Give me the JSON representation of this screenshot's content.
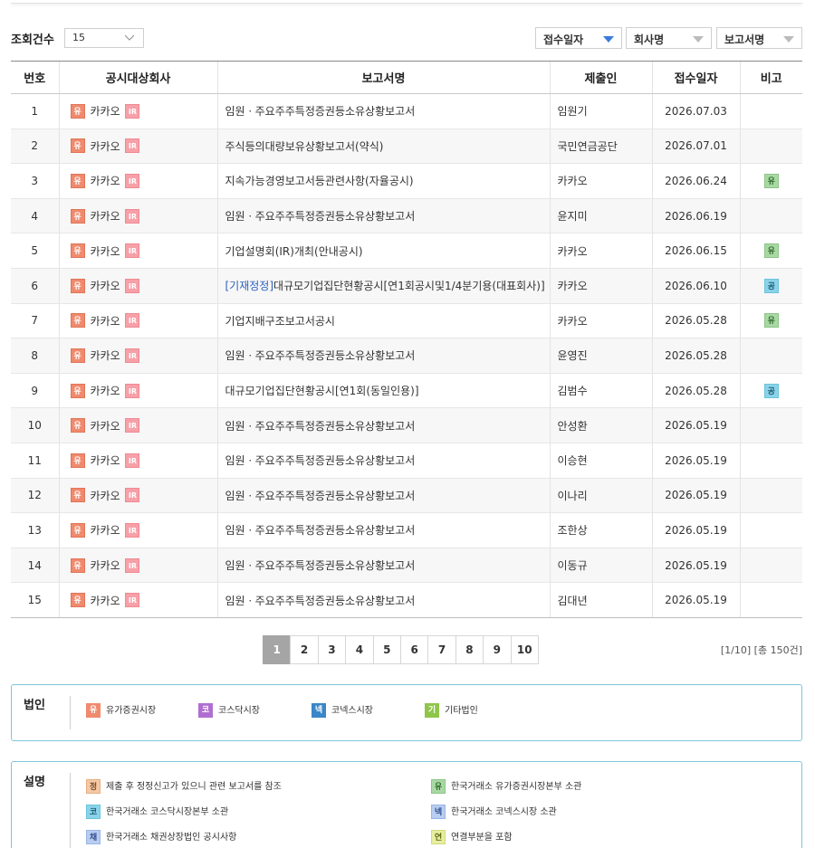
{
  "toolbar": {
    "count_label": "조회건수",
    "count_value": "15",
    "sort_options": [
      "접수일자",
      "회사명",
      "보고서명"
    ]
  },
  "table": {
    "headers": [
      "번호",
      "공시대상회사",
      "보고서명",
      "제출인",
      "접수일자",
      "비고"
    ],
    "rows": [
      {
        "num": "1",
        "market": "유",
        "ir": "IR",
        "company": "카카오",
        "prefix": "",
        "report": "임원ㆍ주요주주특정증권등소유상황보고서",
        "submitter": "임원기",
        "date": "2026.07.03",
        "note": ""
      },
      {
        "num": "2",
        "market": "유",
        "ir": "IR",
        "company": "카카오",
        "prefix": "",
        "report": "주식등의대량보유상황보고서(약식)",
        "submitter": "국민연금공단",
        "date": "2026.07.01",
        "note": ""
      },
      {
        "num": "3",
        "market": "유",
        "ir": "IR",
        "company": "카카오",
        "prefix": "",
        "report": "지속가능경영보고서등관련사항(자율공시)",
        "submitter": "카카오",
        "date": "2026.06.24",
        "note": "유"
      },
      {
        "num": "4",
        "market": "유",
        "ir": "IR",
        "company": "카카오",
        "prefix": "",
        "report": "임원ㆍ주요주주특정증권등소유상황보고서",
        "submitter": "윤지미",
        "date": "2026.06.19",
        "note": ""
      },
      {
        "num": "5",
        "market": "유",
        "ir": "IR",
        "company": "카카오",
        "prefix": "",
        "report": "기업설명회(IR)개최(안내공시)",
        "submitter": "카카오",
        "date": "2026.06.15",
        "note": "유"
      },
      {
        "num": "6",
        "market": "유",
        "ir": "IR",
        "company": "카카오",
        "prefix": "[기재정정]",
        "report": "대규모기업집단현황공시[연1회공시및1/4분기용(대표회사)]",
        "submitter": "카카오",
        "date": "2026.06.10",
        "note": "공"
      },
      {
        "num": "7",
        "market": "유",
        "ir": "IR",
        "company": "카카오",
        "prefix": "",
        "report": "기업지배구조보고서공시",
        "submitter": "카카오",
        "date": "2026.05.28",
        "note": "유"
      },
      {
        "num": "8",
        "market": "유",
        "ir": "IR",
        "company": "카카오",
        "prefix": "",
        "report": "임원ㆍ주요주주특정증권등소유상황보고서",
        "submitter": "윤영진",
        "date": "2026.05.28",
        "note": ""
      },
      {
        "num": "9",
        "market": "유",
        "ir": "IR",
        "company": "카카오",
        "prefix": "",
        "report": "대규모기업집단현황공시[연1회(동일인용)]",
        "submitter": "김범수",
        "date": "2026.05.28",
        "note": "공"
      },
      {
        "num": "10",
        "market": "유",
        "ir": "IR",
        "company": "카카오",
        "prefix": "",
        "report": "임원ㆍ주요주주특정증권등소유상황보고서",
        "submitter": "안성환",
        "date": "2026.05.19",
        "note": ""
      },
      {
        "num": "11",
        "market": "유",
        "ir": "IR",
        "company": "카카오",
        "prefix": "",
        "report": "임원ㆍ주요주주특정증권등소유상황보고서",
        "submitter": "이승현",
        "date": "2026.05.19",
        "note": ""
      },
      {
        "num": "12",
        "market": "유",
        "ir": "IR",
        "company": "카카오",
        "prefix": "",
        "report": "임원ㆍ주요주주특정증권등소유상황보고서",
        "submitter": "이나리",
        "date": "2026.05.19",
        "note": ""
      },
      {
        "num": "13",
        "market": "유",
        "ir": "IR",
        "company": "카카오",
        "prefix": "",
        "report": "임원ㆍ주요주주특정증권등소유상황보고서",
        "submitter": "조한상",
        "date": "2026.05.19",
        "note": ""
      },
      {
        "num": "14",
        "market": "유",
        "ir": "IR",
        "company": "카카오",
        "prefix": "",
        "report": "임원ㆍ주요주주특정증권등소유상황보고서",
        "submitter": "이동규",
        "date": "2026.05.19",
        "note": ""
      },
      {
        "num": "15",
        "market": "유",
        "ir": "IR",
        "company": "카카오",
        "prefix": "",
        "report": "임원ㆍ주요주주특정증권등소유상황보고서",
        "submitter": "김대년",
        "date": "2026.05.19",
        "note": ""
      }
    ]
  },
  "pagination": {
    "pages": [
      "1",
      "2",
      "3",
      "4",
      "5",
      "6",
      "7",
      "8",
      "9",
      "10"
    ],
    "current": "1",
    "info": "[1/10] [총 150건]"
  },
  "corp_legend": {
    "title": "법인",
    "items": [
      {
        "mark": "유",
        "label": "유가증권시장"
      },
      {
        "mark": "코",
        "label": "코스닥시장"
      },
      {
        "mark": "넥",
        "label": "코넥스시장"
      },
      {
        "mark": "기",
        "label": "기타법인"
      }
    ]
  },
  "explain_legend": {
    "title": "설명",
    "items": [
      {
        "mark": "정",
        "label": "제출 후 정정신고가 있으니 관련 보고서를 참조"
      },
      {
        "mark": "유",
        "label": "한국거래소 유가증권시장본부 소관"
      },
      {
        "mark": "코",
        "label": "한국거래소 코스닥시장본부 소관"
      },
      {
        "mark": "넥",
        "label": "한국거래소 코넥스시장 소관"
      },
      {
        "mark": "채",
        "label": "한국거래소 채권상장법인 공시사항"
      },
      {
        "mark": "연",
        "label": "연결부분을 포함"
      }
    ]
  },
  "colors": {
    "accent_blue": "#3b7be0",
    "legend_border": "#7fc6d8",
    "market_yu": "#f08a6e"
  }
}
